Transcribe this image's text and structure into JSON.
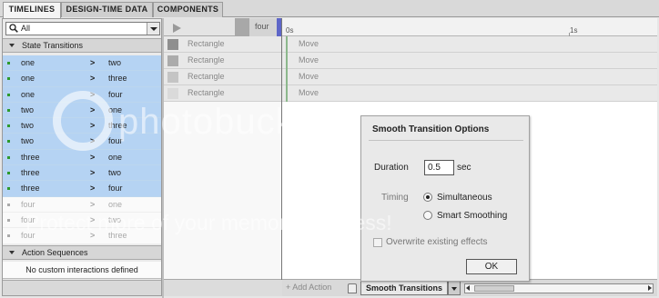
{
  "tabs": [
    "TIMELINES",
    "DESIGN-TIME DATA",
    "COMPONENTS"
  ],
  "search": {
    "value": "All"
  },
  "sections": {
    "state_transitions": "State Transitions",
    "action_sequences": "Action Sequences"
  },
  "transitions": [
    {
      "from": "one",
      "arrow": ">",
      "to": "two",
      "state": "selected"
    },
    {
      "from": "one",
      "arrow": ">",
      "to": "three",
      "state": "selected"
    },
    {
      "from": "one",
      "arrow": ">",
      "to": "four",
      "state": "selected"
    },
    {
      "from": "two",
      "arrow": ">",
      "to": "one",
      "state": "selected"
    },
    {
      "from": "two",
      "arrow": ">",
      "to": "three",
      "state": "selected"
    },
    {
      "from": "two",
      "arrow": ">",
      "to": "four",
      "state": "selected"
    },
    {
      "from": "three",
      "arrow": ">",
      "to": "one",
      "state": "selected"
    },
    {
      "from": "three",
      "arrow": ">",
      "to": "two",
      "state": "selected"
    },
    {
      "from": "three",
      "arrow": ">",
      "to": "four",
      "state": "selected"
    },
    {
      "from": "four",
      "arrow": ">",
      "to": "one",
      "state": "dim"
    },
    {
      "from": "four",
      "arrow": ">",
      "to": "two",
      "state": "dim"
    },
    {
      "from": "four",
      "arrow": ">",
      "to": "three",
      "state": "dim"
    }
  ],
  "no_interactions": "No custom interactions defined",
  "state_chip": "four",
  "ruler": {
    "start": "0s",
    "end": "1s"
  },
  "objects": [
    {
      "name": "Rectangle",
      "color": "#8f8f8f"
    },
    {
      "name": "Rectangle",
      "color": "#ababab"
    },
    {
      "name": "Rectangle",
      "color": "#c4c4c4"
    },
    {
      "name": "Rectangle",
      "color": "#dadada"
    }
  ],
  "actions": [
    "Move",
    "Move",
    "Move",
    "Move"
  ],
  "footer": {
    "add_action": "+ Add Action",
    "smooth_transitions": "Smooth Transitions"
  },
  "dialog": {
    "title": "Smooth Transition Options",
    "duration_label": "Duration",
    "duration_value": "0.5",
    "duration_unit": "sec",
    "timing_label": "Timing",
    "options": [
      {
        "label": "Simultaneous",
        "selected": true
      },
      {
        "label": "Smart Smoothing",
        "selected": false
      }
    ],
    "overwrite_label": "Overwrite existing effects",
    "ok_label": "OK"
  },
  "watermark": {
    "main": "photobucket",
    "sub": "Protect more of your memories for less!"
  }
}
